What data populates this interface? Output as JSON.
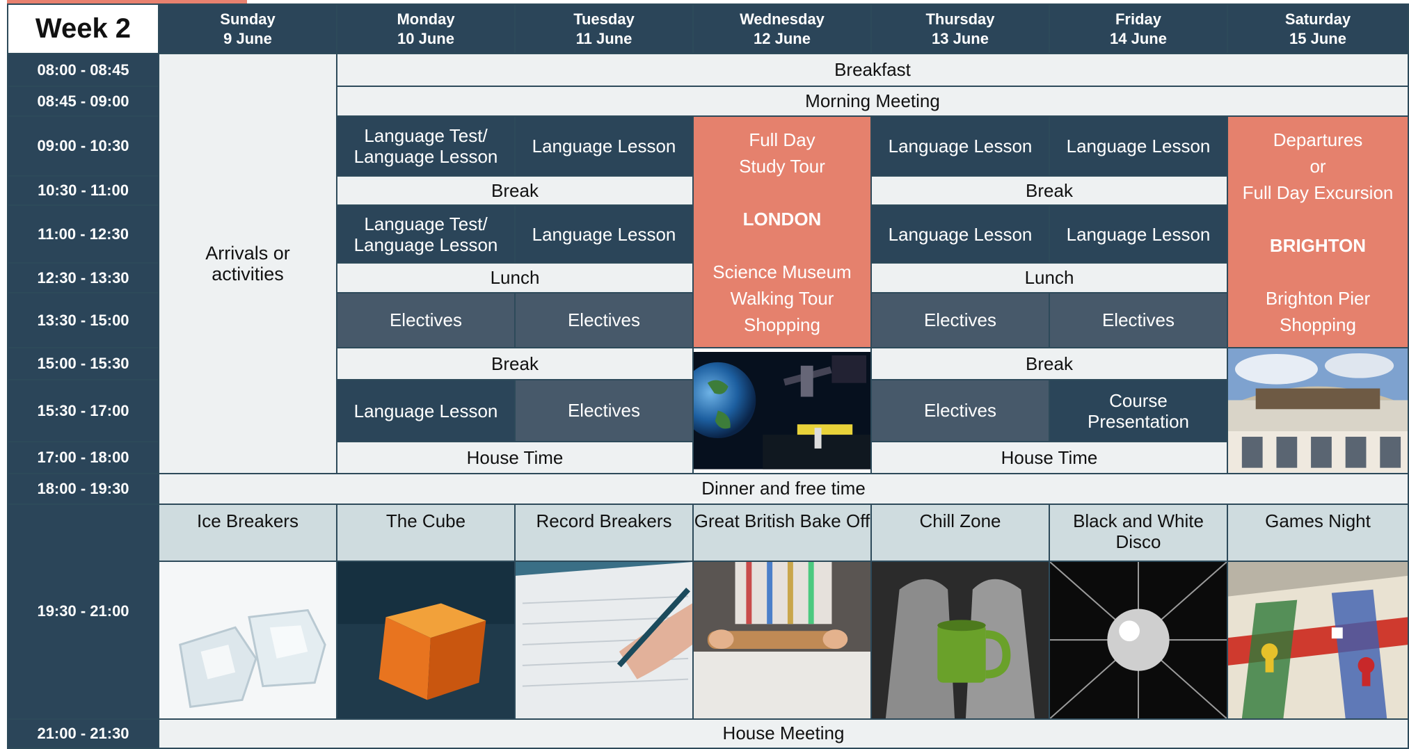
{
  "week_label": "Week 2",
  "days": [
    {
      "name": "Sunday",
      "date": "9 June"
    },
    {
      "name": "Monday",
      "date": "10 June"
    },
    {
      "name": "Tuesday",
      "date": "11 June"
    },
    {
      "name": "Wednesday",
      "date": "12 June"
    },
    {
      "name": "Thursday",
      "date": "13 June"
    },
    {
      "name": "Friday",
      "date": "14 June"
    },
    {
      "name": "Saturday",
      "date": "15 June"
    }
  ],
  "times": [
    "08:00 - 08:45",
    "08:45 - 09:00",
    "09:00 - 10:30",
    "10:30 - 11:00",
    "11:00 - 12:30",
    "12:30 - 13:30",
    "13:30 - 15:00",
    "15:00 - 15:30",
    "15:30 - 17:00",
    "17:00 - 18:00",
    "18:00 - 19:30",
    "19:30 - 21:00",
    "21:00 - 21:30"
  ],
  "sunday_block": [
    "Arrivals or",
    "activities"
  ],
  "activities": {
    "breakfast": "Breakfast",
    "morning_meeting": "Morning Meeting",
    "language_test": [
      "Language Test/",
      "Language Lesson"
    ],
    "language_lesson": "Language Lesson",
    "break": "Break",
    "lunch": "Lunch",
    "electives": "Electives",
    "house_time": "House Time",
    "course_presentation": [
      "Course",
      "Presentation"
    ],
    "dinner": "Dinner and free time",
    "house_meeting": "House Meeting"
  },
  "wednesday_tour": {
    "line1": "Full Day",
    "line2": "Study Tour",
    "city": "LONDON",
    "items": [
      "Science Museum",
      "Walking Tour",
      "Shopping"
    ]
  },
  "saturday_tour": {
    "line1": "Departures",
    "line2": "or",
    "line3": "Full Day Excursion",
    "city": "BRIGHTON",
    "items": [
      "Brighton Pier",
      "Shopping"
    ]
  },
  "evening_events": [
    "Ice Breakers",
    "The Cube",
    "Record Breakers",
    "Great British Bake Off",
    "Chill Zone",
    "Black and White Disco",
    "Games Night"
  ],
  "colors": {
    "header_navy": "#2b4559",
    "salmon": "#e5816d",
    "light": "#eef1f2",
    "slate": "#47596a",
    "event_title": "#cfdcdf"
  }
}
